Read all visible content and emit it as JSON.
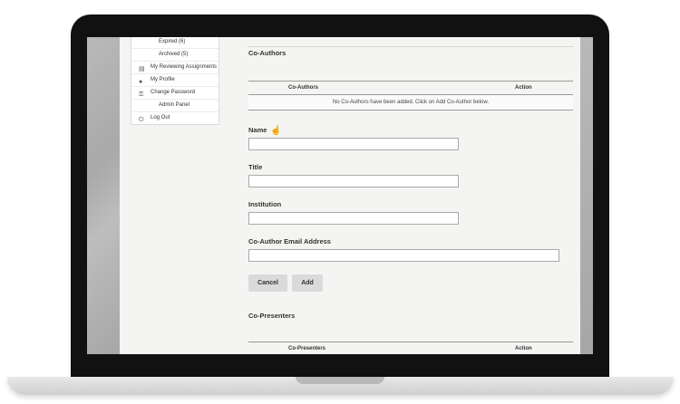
{
  "sidebar": {
    "items": [
      {
        "label": "Expired (6)",
        "icon": ""
      },
      {
        "label": "Archived (5)",
        "icon": ""
      },
      {
        "label": "My Reviewing Assignments",
        "icon": "document-icon"
      },
      {
        "label": "My Profile",
        "icon": "user-icon"
      },
      {
        "label": "Change Password",
        "icon": "key-icon"
      },
      {
        "label": "Admin Panel",
        "icon": ""
      },
      {
        "label": "Log Out",
        "icon": "power-icon"
      }
    ]
  },
  "coauthors": {
    "title": "Co-Authors",
    "table": {
      "columns": [
        "Co-Authors",
        "Action"
      ],
      "empty_message": "No Co-Authors have been added. Click on Add Co-Author below."
    }
  },
  "form": {
    "name_label": "Name",
    "title_label": "Title",
    "institution_label": "Institution",
    "email_label": "Co-Author Email Address",
    "name_value": "",
    "title_value": "",
    "institution_value": "",
    "email_value": ""
  },
  "buttons": {
    "cancel": "Cancel",
    "add": "Add"
  },
  "copresenters": {
    "title": "Co-Presenters",
    "table": {
      "columns": [
        "Co-Presenters",
        "Action"
      ]
    }
  }
}
